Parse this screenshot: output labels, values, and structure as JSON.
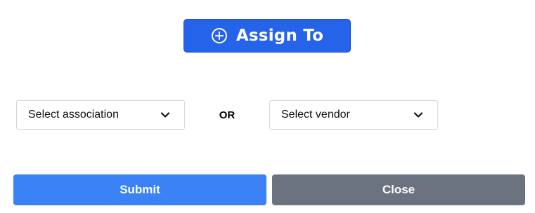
{
  "header": {
    "assign_label": "Assign To",
    "assign_icon": "plus-circle-icon"
  },
  "form": {
    "association_select": {
      "selected": "Select association",
      "icon": "chevron-down-icon"
    },
    "separator": "OR",
    "vendor_select": {
      "selected": "Select vendor",
      "icon": "chevron-down-icon"
    }
  },
  "footer": {
    "submit_label": "Submit",
    "close_label": "Close"
  },
  "colors": {
    "primary": "#2563eb",
    "submit": "#3b82f6",
    "close": "#6b7280"
  }
}
